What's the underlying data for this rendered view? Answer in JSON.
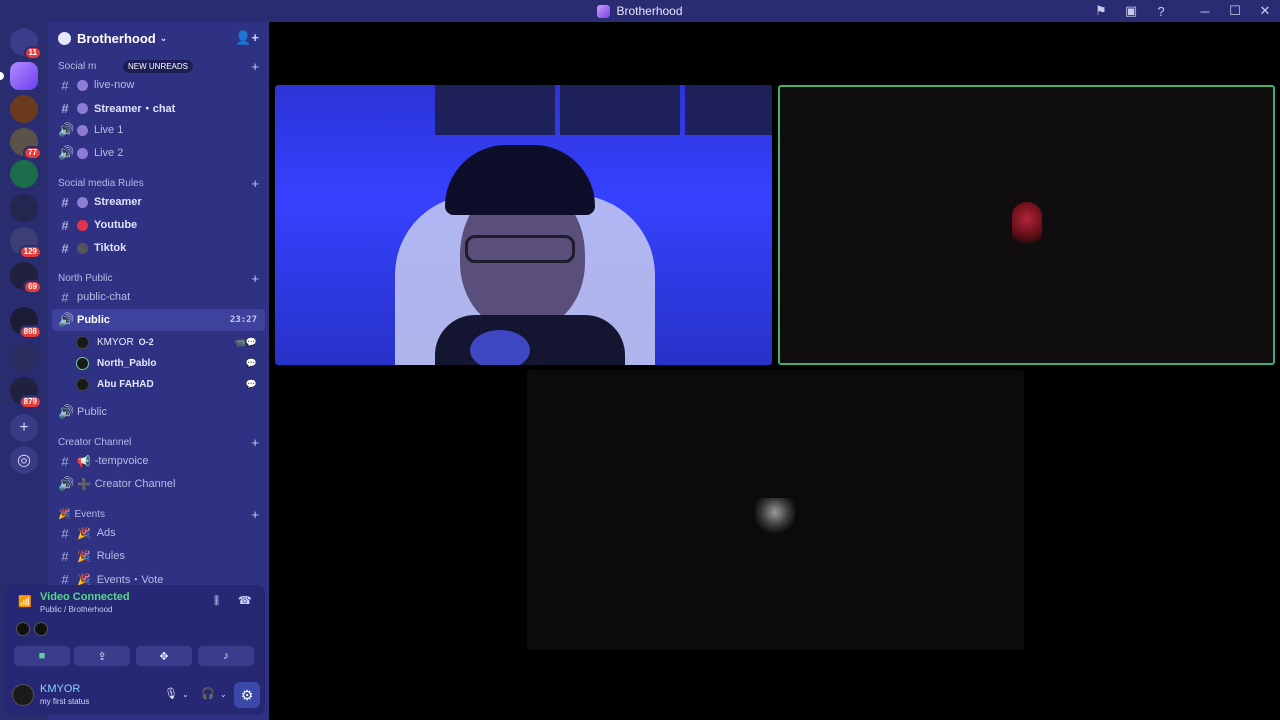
{
  "window": {
    "title": "Brotherhood"
  },
  "rail": {
    "badges": [
      "11",
      "77",
      "129",
      "69",
      "898",
      "879"
    ]
  },
  "guild": {
    "name": "Brotherhood"
  },
  "new_unreads": "NEW UNREADS",
  "categories": {
    "social_live": "Social m",
    "social_rules": "Social media Rules",
    "north_public": "North Public",
    "creator": "Creator Channel",
    "events": "Events"
  },
  "channels": {
    "live_now": "live-now",
    "streamer_chat": "Streamer・chat",
    "live1": "Live 1",
    "live2": "Live 2",
    "streamer": "Streamer",
    "youtube": "Youtube",
    "tiktok": "Tiktok",
    "public_chat": "public-chat",
    "public_voice": "Public",
    "public_time": "23:27",
    "public2": "Public",
    "tempvoice": "-tempvoice",
    "creator_channel": "Creator Channel",
    "ads": "Ads",
    "rules": "Rules",
    "events_vote": "Events・Vote"
  },
  "voice_users": [
    {
      "name": "KMYOR",
      "tag": "O-2"
    },
    {
      "name": "North_Pablo"
    },
    {
      "name": "Abu FAHAD"
    }
  ],
  "voice_panel": {
    "status": "Video Connected",
    "location": "Public / Brotherhood"
  },
  "account": {
    "name": "KMYOR",
    "status": "my first status"
  },
  "colors": {
    "sidebar": "#2f3182",
    "rail": "#2a2c70",
    "connected_green": "#58d68d",
    "speaking_border": "#3fae6e"
  },
  "icons": {
    "sidebar": [
      "hashtag-icon",
      "speaker-icon",
      "plus-icon",
      "chevron-down-icon"
    ],
    "voice": [
      "signal-icon",
      "soundwave-icon",
      "hangup-icon",
      "camera-icon",
      "screenshare-icon",
      "activities-icon",
      "soundboard-icon"
    ],
    "account": [
      "mic-icon",
      "headphones-icon",
      "gear-icon"
    ]
  }
}
